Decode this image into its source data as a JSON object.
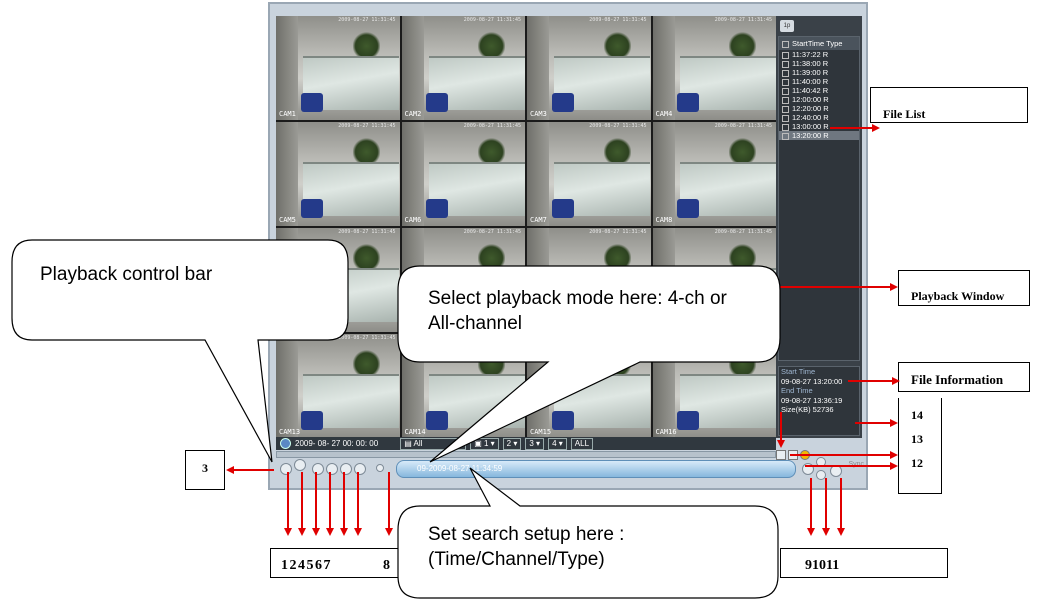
{
  "dvr": {
    "cameras": [
      {
        "label": "CAM1"
      },
      {
        "label": "CAM2"
      },
      {
        "label": "CAM3"
      },
      {
        "label": "CAM4"
      },
      {
        "label": "CAM5"
      },
      {
        "label": "CAM6"
      },
      {
        "label": "CAM7"
      },
      {
        "label": "CAM8"
      },
      {
        "label": ""
      },
      {
        "label": ""
      },
      {
        "label": ""
      },
      {
        "label": ""
      },
      {
        "label": "CAM13"
      },
      {
        "label": "CAM14"
      },
      {
        "label": "CAM15"
      },
      {
        "label": "CAM16"
      }
    ],
    "camera_timestamp": "2009-08-27 11:31:45",
    "file_list": {
      "header": "StartTime Type",
      "rows": [
        {
          "text": "11:37:22  R"
        },
        {
          "text": "11:38:00  R"
        },
        {
          "text": "11:39:00  R"
        },
        {
          "text": "11:40:00  R"
        },
        {
          "text": "11:40:42  R"
        },
        {
          "text": "12:00:00  R"
        },
        {
          "text": "12:20:00  R"
        },
        {
          "text": "12:40:00  R"
        },
        {
          "text": "13:00:00  R"
        },
        {
          "text": "13:20:00  R"
        }
      ],
      "selected_index": 9
    },
    "file_info": {
      "start_label": "Start Time",
      "start_value": "09-08-27 13:20:00",
      "end_label": "End Time",
      "end_value": "09-08-27 13:36:19",
      "size": "Size(KB)  52736"
    },
    "search_bar": {
      "datetime": "2009- 08- 27  00: 00: 00",
      "type": "All",
      "ch1": "1",
      "ch2": "2",
      "ch3": "3",
      "ch4": "4",
      "all": "ALL"
    },
    "timebar_text": "09-2009-08-27 11:34:59",
    "sync_text": "Sync"
  },
  "annotations": {
    "file_list": "File List",
    "playback_window": "Playback Window",
    "file_information": "File Information",
    "n14": "14",
    "n13": "13",
    "n12": "12",
    "n3": "3",
    "left_numbers": "1 2 4 5 6 7",
    "n8": "8",
    "right_numbers": "91011"
  },
  "callouts": {
    "control_bar": "Playback control bar",
    "mode": "Select playback mode here: 4-ch or All-channel",
    "search": "Set search setup here : (Time/Channel/Type)"
  },
  "colors": {
    "arrow": "#e00000",
    "accent": "#86b7dd"
  }
}
